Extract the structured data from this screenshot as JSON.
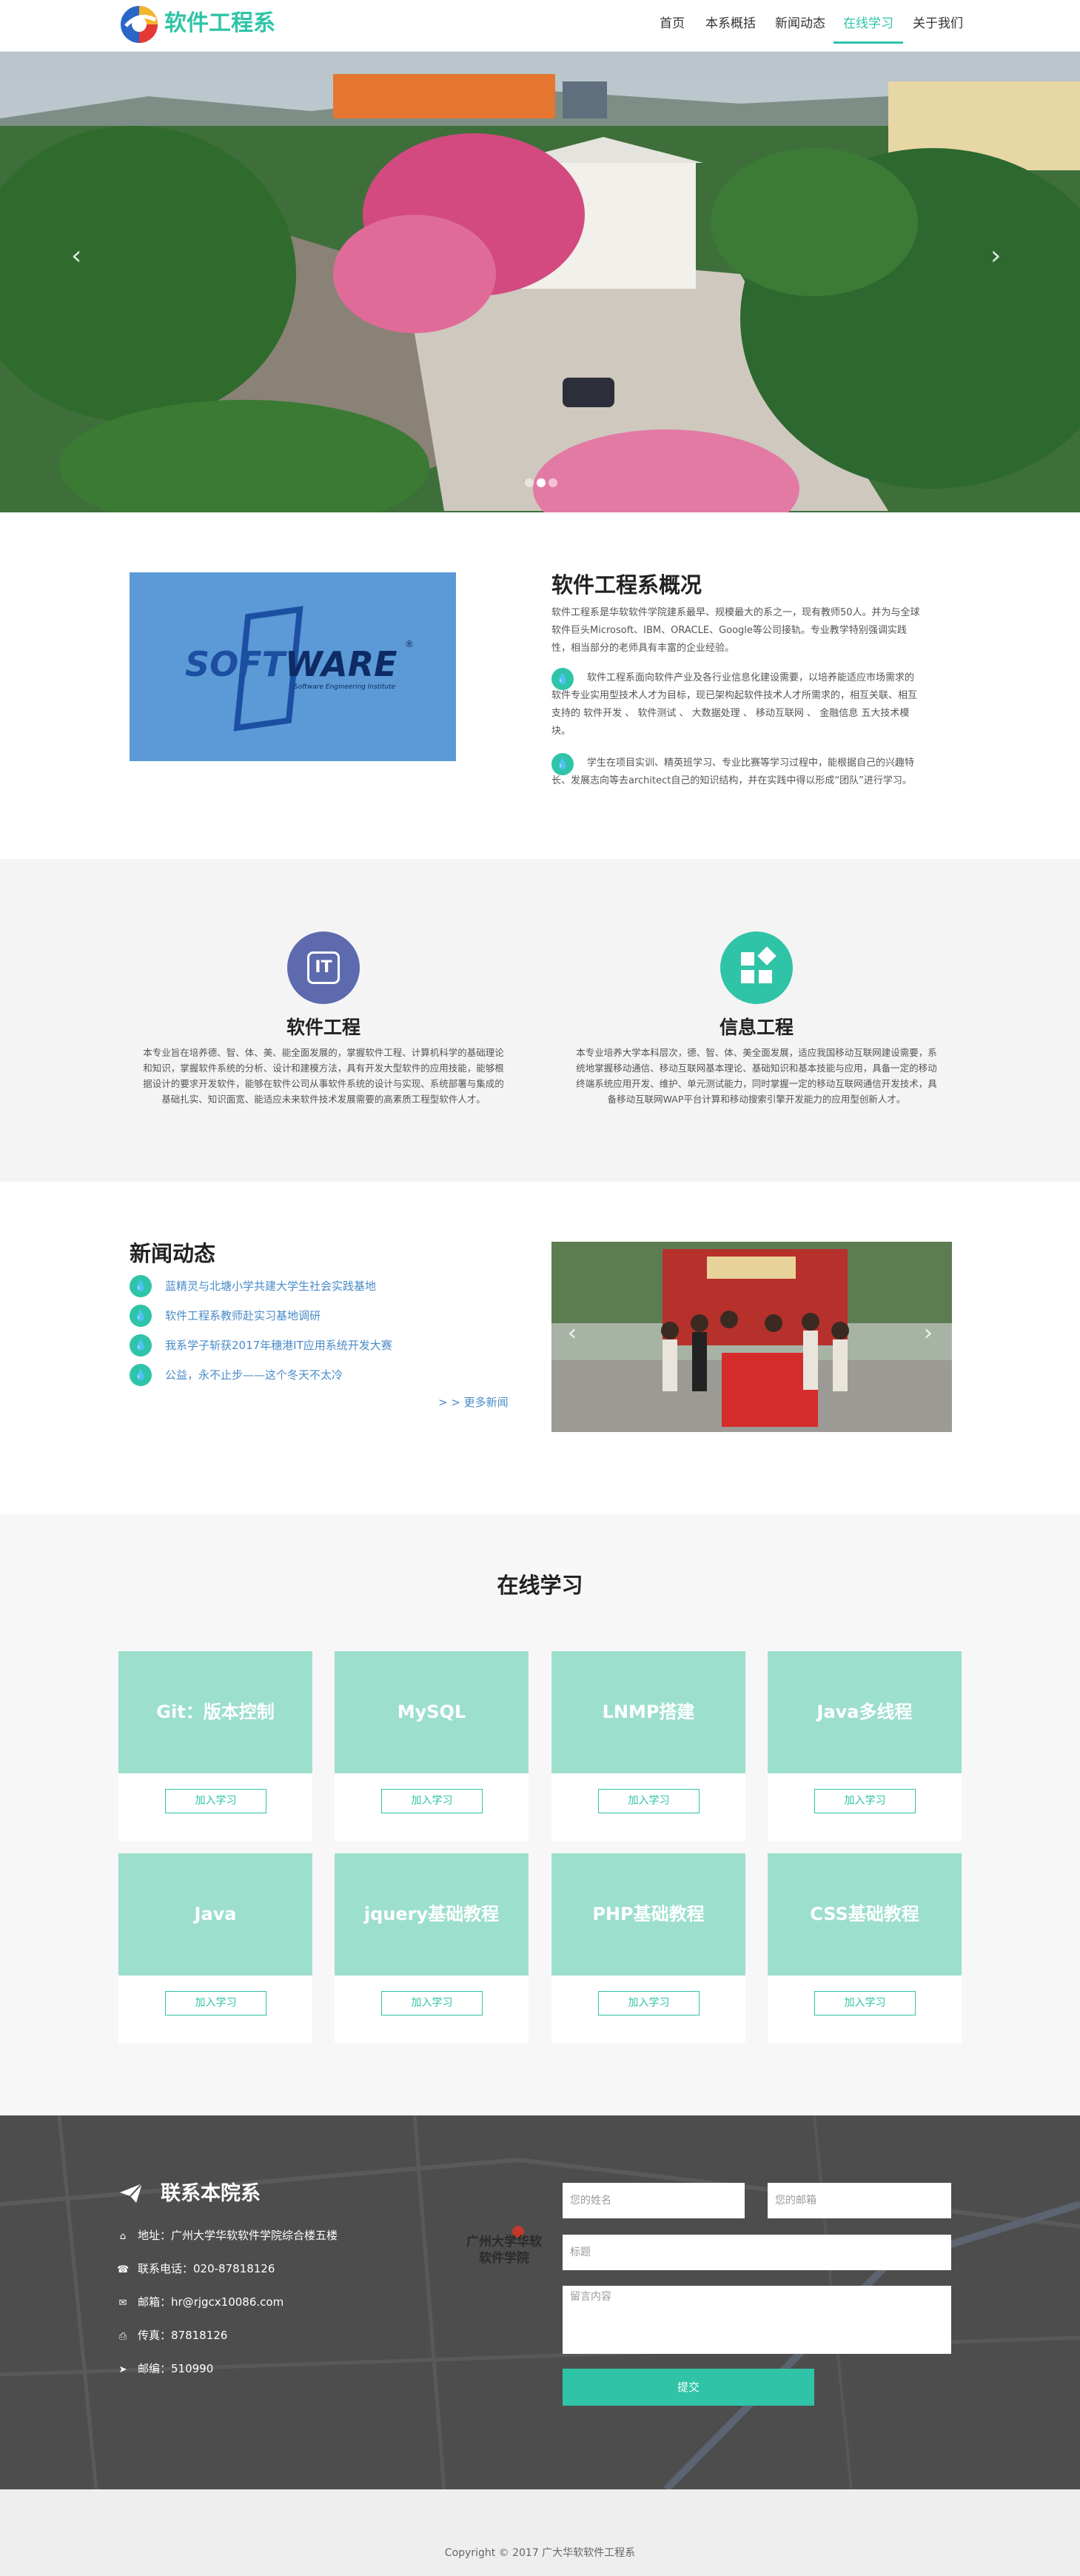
{
  "nav": {
    "logo_text": "软件工程系",
    "items": [
      {
        "label": "首页"
      },
      {
        "label": "本系概括"
      },
      {
        "label": "新闻动态"
      },
      {
        "label": "在线学习",
        "active": true
      },
      {
        "label": "关于我们"
      }
    ]
  },
  "banner": {
    "slide_count": 3,
    "active_slide": 2
  },
  "overview": {
    "logo_word_blue": "SOFT",
    "logo_word_dark": "WARE",
    "logo_reg": "®",
    "logo_sub": "Software Engineering Institute",
    "title": "软件工程系概况",
    "intro_lines": [
      "软件工程系是华软软件学院建系最早、规模最大的系之一，现有教师50人。并为与全球",
      "软件巨头Microsoft、IBM、ORACLE、Google等公司接轨。专业教学特别强调实践",
      "性，相当部分的老师具有丰富的企业经验。"
    ],
    "point1_lines": [
      "软件工程系面向软件产业及各行业信息化建设需要，以培养能适应市场需求的",
      "软件专业实用型技术人才为目标，现已架构起软件技术人才所需求的，相互关联、相互",
      "支持的 软件开发 、 软件测试 、 大数据处理 、 移动互联网 、 金融信息 五大技术模",
      "块。"
    ],
    "point2_lines": [
      "学生在项目实训、精英班学习、专业比赛等学习过程中，能根据自己的兴趣特",
      "长、发展志向等去architect自己的知识结构，并在实践中得以形成“团队”进行学习。"
    ]
  },
  "majors": [
    {
      "icon_text": "IT",
      "title": "软件工程",
      "lines": [
        "本专业旨在培养德、智、体、美、能全面发展的，掌握软件工程、计算机科学的基础理论",
        "和知识，掌握软件系统的分析、设计和建模方法，具有开发大型软件的应用技能，能够根",
        "据设计的要求开发软件，能够在软件公司从事软件系统的设计与实现、系统部署与集成的",
        "基础扎实、知识面宽、能适应未来软件技术发展需要的高素质工程型软件人才。"
      ]
    },
    {
      "title": "信息工程",
      "lines": [
        "本专业培养大学本科层次，德、智、体、美全面发展，适应我国移动互联网建设需要，系",
        "统地掌握移动通信、移动互联网基本理论、基础知识和基本技能与应用，具备一定的移动",
        "终端系统应用开发、维护、单元测试能力，同时掌握一定的移动互联网通信开发技术，具",
        "备移动互联网WAP平台计算和移动搜索引擎开发能力的应用型创新人才。"
      ]
    }
  ],
  "news": {
    "title": "新闻动态",
    "items": [
      {
        "text": "蓝精灵与北塘小学共建大学生社会实践基地"
      },
      {
        "text": "软件工程系教师赴实习基地调研"
      },
      {
        "text": "我系学子斩获2017年穗港IT应用系统开发大赛"
      },
      {
        "text": "公益，永不止步——这个冬天不太冷"
      }
    ],
    "more": "> > 更多新闻"
  },
  "courses": {
    "title": "在线学习",
    "button_label": "加入学习",
    "items": [
      {
        "name": "Git：版本控制"
      },
      {
        "name": "MySQL"
      },
      {
        "name": "LNMP搭建"
      },
      {
        "name": "Java多线程"
      },
      {
        "name": "Java"
      },
      {
        "name": "jquery基础教程"
      },
      {
        "name": "PHP基础教程"
      },
      {
        "name": "CSS基础教程"
      }
    ]
  },
  "contact": {
    "title": "联系本院系",
    "rows": [
      {
        "icon": "home-icon",
        "text": "地址：广州大学华软软件学院综合楼五楼"
      },
      {
        "icon": "phone-icon",
        "text": "联系电话：020-87818126"
      },
      {
        "icon": "mail-icon",
        "text": "邮箱：hr@rjgcx10086.com"
      },
      {
        "icon": "fax-icon",
        "text": "传真：87818126"
      },
      {
        "icon": "send-icon",
        "text": "邮编：510990"
      }
    ],
    "form": {
      "name_placeholder": "您的姓名",
      "email_placeholder": "您的邮箱",
      "subject_placeholder": "标题",
      "message_placeholder": "留言内容",
      "submit_label": "提交"
    },
    "map_label_1": "广州大学华软",
    "map_label_2": "软件学院"
  },
  "footer": {
    "copyright": "Copyright © 2017  广大华软软件工程系"
  },
  "colors": {
    "accent": "#2fc4a7",
    "card_head": "#9ddfcd",
    "it_circle": "#5d6aad",
    "link": "#4a8bc7"
  }
}
